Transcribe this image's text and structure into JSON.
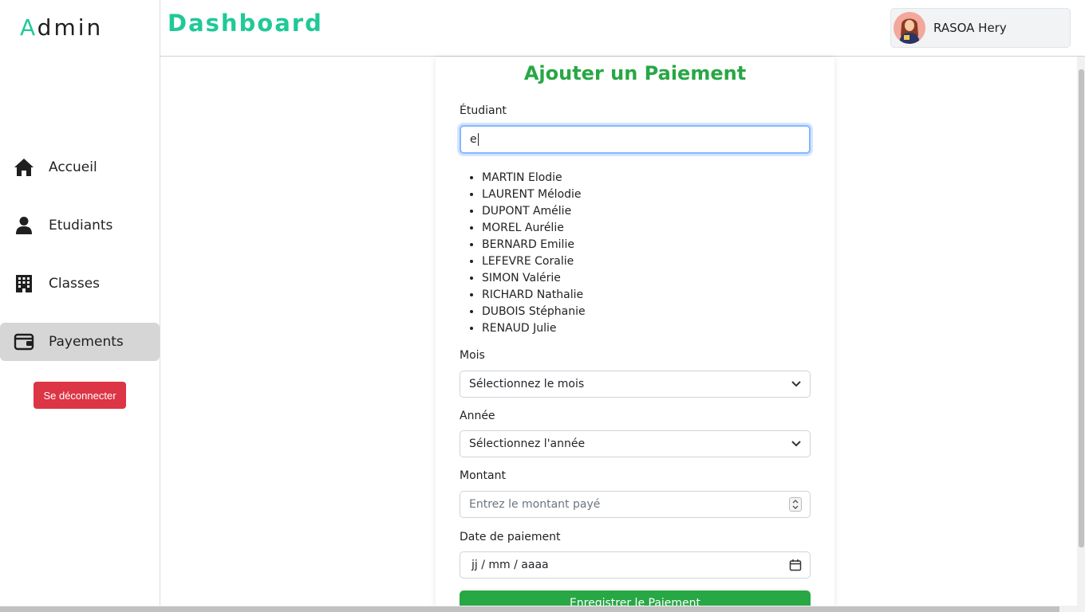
{
  "sidebar": {
    "brand_first": "A",
    "brand_rest": "dmin",
    "items": [
      {
        "label": "Accueil",
        "icon": "home-icon"
      },
      {
        "label": "Etudiants",
        "icon": "user-icon"
      },
      {
        "label": "Classes",
        "icon": "building-icon"
      },
      {
        "label": "Payements",
        "icon": "wallet-icon",
        "active": true
      }
    ],
    "logout_label": "Se déconnecter"
  },
  "header": {
    "title": "Dashboard",
    "user_name": "RASOA Hery"
  },
  "form": {
    "title": "Ajouter un Paiement",
    "student_label": "Étudiant",
    "student_value": "e",
    "suggestions": [
      "MARTIN Elodie",
      "LAURENT Mélodie",
      "DUPONT Amélie",
      "MOREL Aurélie",
      "BERNARD Emilie",
      "LEFEVRE Coralie",
      "SIMON Valérie",
      "RICHARD Nathalie",
      "DUBOIS Stéphanie",
      "RENAUD Julie"
    ],
    "month_label": "Mois",
    "month_value": "Sélectionnez le mois",
    "year_label": "Année",
    "year_value": "Sélectionnez l'année",
    "amount_label": "Montant",
    "amount_placeholder": "Entrez le montant payé",
    "date_label": "Date de paiement",
    "date_placeholder": "jj / mm / aaaa",
    "submit_label": "Enregistrer le Paiement"
  },
  "colors": {
    "accent": "#20c997",
    "form_title": "#28a745",
    "submit": "#28a745",
    "logout": "#dc3545",
    "active_nav": "#d6d6d6"
  }
}
